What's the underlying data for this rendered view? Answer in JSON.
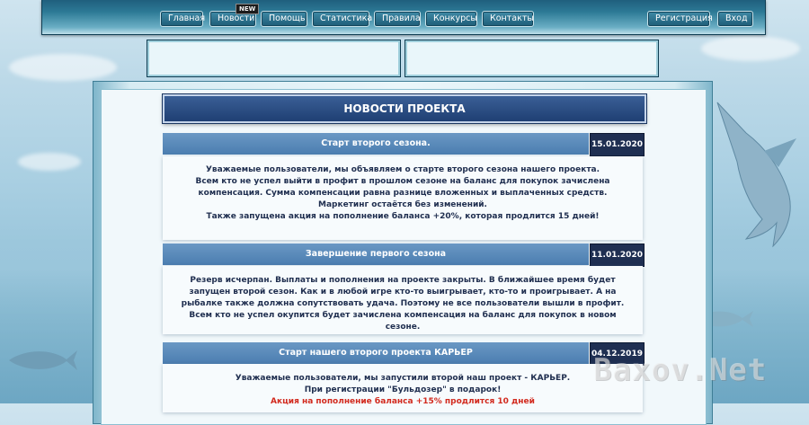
{
  "nav": {
    "left": [
      {
        "label": "Главная"
      },
      {
        "label": "Новости",
        "badge": "NEW"
      },
      {
        "label": "Помощь"
      },
      {
        "label": "Статистика"
      },
      {
        "label": "Правила"
      },
      {
        "label": "Конкурсы"
      },
      {
        "label": "Контакты"
      }
    ],
    "right": [
      {
        "label": "Регистрация"
      },
      {
        "label": "Вход"
      }
    ]
  },
  "section_title": "НОВОСТИ ПРОЕКТА",
  "news": [
    {
      "title": "Старт второго сезона.",
      "date": "15.01.2020",
      "lines": [
        "Уважаемые пользователи, мы объявляем о старте второго сезона нашего проекта.",
        "Всем кто не успел выйти в профит в прошлом сезоне на баланс для покупок зачислена компенсация. Сумма компенсации равна разнице вложенных и выплаченных средств.",
        "Маркетинг остаётся без изменений.",
        "Также запущена акция на пополнение баланса +20%, которая продлится 15 дней!"
      ]
    },
    {
      "title": "Завершение первого сезона",
      "date": "11.01.2020",
      "lines": [
        "Резерв исчерпан. Выплаты и пополнения на проекте закрыты. В ближайшее время будет запущен второй сезон. Как и в любой игре кто-то выигрывает, кто-то и проигрывает. А на рыбалке также должна сопутствовать удача. Поэтому не все пользователи вышли в профит. Всем кто не успел окупится будет зачислена компенсация на баланс для покупок в новом сезоне."
      ]
    },
    {
      "title": "Старт нашего второго проекта КАРЬЕР",
      "date": "04.12.2019",
      "lines": [
        "Уважаемые пользователи, мы запустили второй наш проект - КАРЬЕР.",
        "При регистрации \"Бульдозер\" в подарок!"
      ],
      "highlight": "Акция на пополнение баланса +15% продлится 10 дней"
    }
  ],
  "watermark": "Baxov.Net",
  "colors": {
    "nav_button": "#1e5d78",
    "title_bar": "#1f3f73",
    "news_header": "#4b7db0",
    "date_badge": "#1f2f52",
    "highlight": "#d22a1e"
  }
}
